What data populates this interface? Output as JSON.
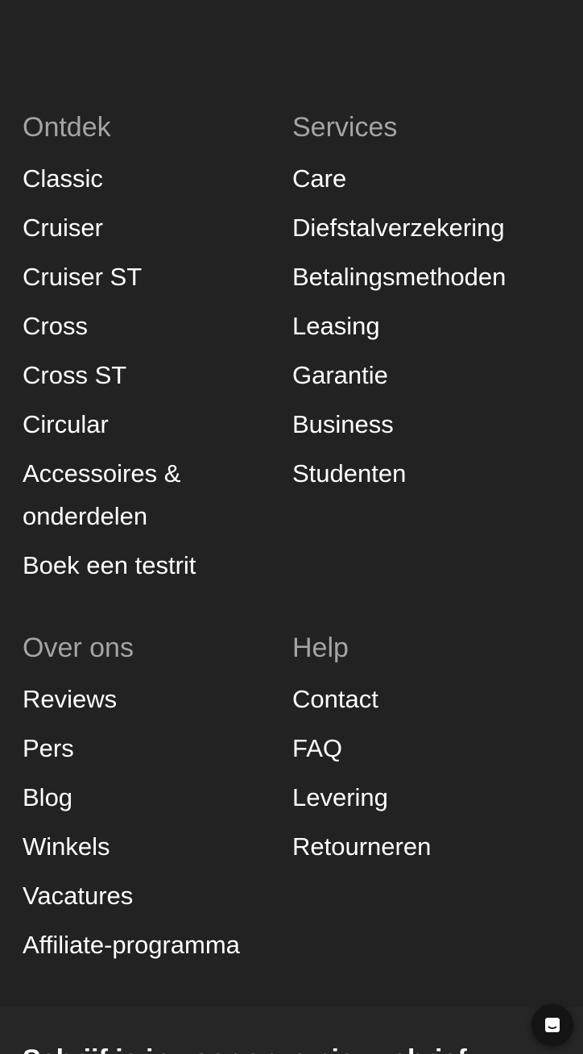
{
  "footer": {
    "ontdek": {
      "title": "Ontdek",
      "items": [
        "Classic",
        "Cruiser",
        "Cruiser ST",
        "Cross",
        "Cross ST",
        "Circular",
        "Accessoires & onderdelen",
        "Boek een testrit"
      ]
    },
    "services": {
      "title": "Services",
      "items": [
        "Care",
        "Diefstalverzekering",
        "Betalingsmethoden",
        "Leasing",
        "Garantie",
        "Business",
        "Studenten"
      ]
    },
    "over_ons": {
      "title": "Over ons",
      "items": [
        "Reviews",
        "Pers",
        "Blog",
        "Winkels",
        "Vacatures",
        "Affiliate-programma"
      ]
    },
    "help": {
      "title": "Help",
      "items": [
        "Contact",
        "FAQ",
        "Levering",
        "Retourneren"
      ]
    }
  },
  "newsletter": {
    "title": "Schrijf je in voor onze nieuwsbrief"
  },
  "chat": {
    "icon": "chat-icon"
  },
  "colors": {
    "background": "#222222",
    "heading": "#a4a4a4",
    "link": "#ffffff"
  }
}
